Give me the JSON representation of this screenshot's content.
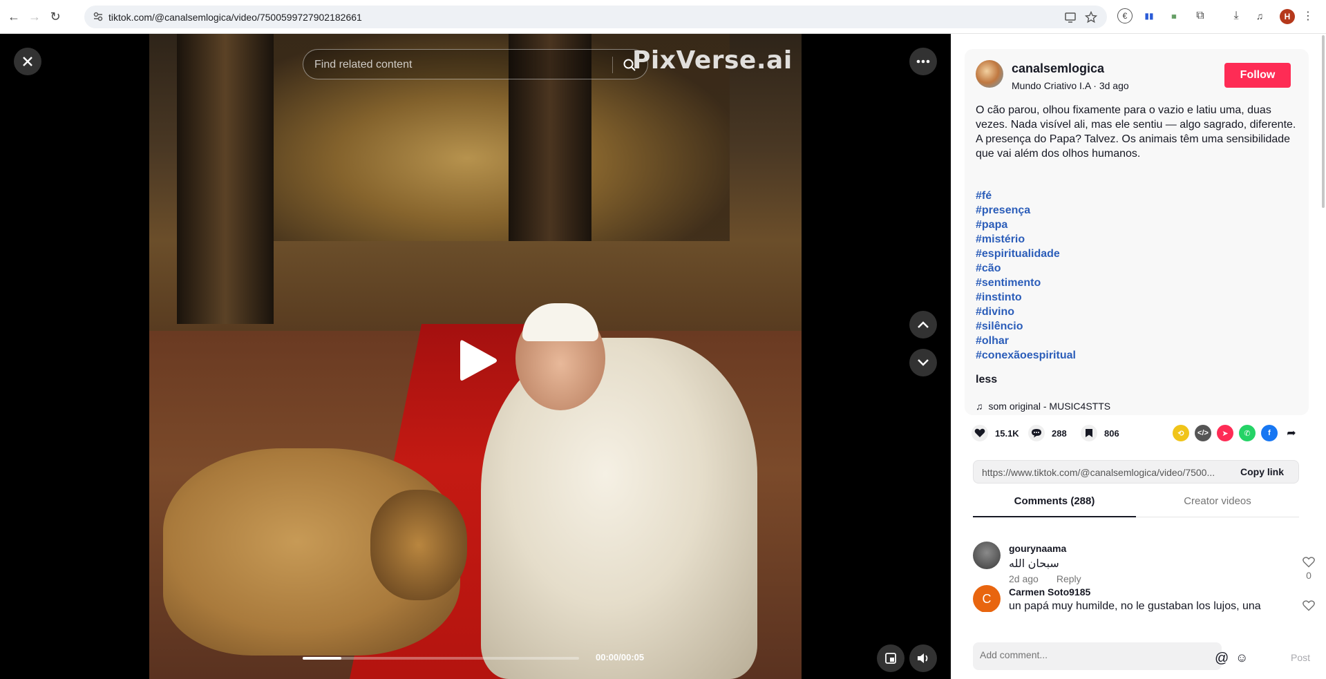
{
  "browser": {
    "url": "tiktok.com/@canalsemlogica/video/7500599727902182661",
    "profile_initial": "H"
  },
  "video": {
    "search_placeholder": "Find related content",
    "watermark": "PixVerse.ai",
    "time": "00:00/00:05",
    "progress_fraction": 0.14
  },
  "author": {
    "username": "canalsemlogica",
    "subline": "Mundo Criativo I.A · 3d ago",
    "follow_label": "Follow"
  },
  "caption": "O cão parou, olhou fixamente para o vazio e latiu uma, duas vezes. Nada visível ali, mas ele sentiu — algo sagrado, diferente. A presença do Papa? Talvez. Os animais têm uma sensibilidade que vai além dos olhos humanos.",
  "hashtags": [
    "#fé",
    "#presença",
    "#papa",
    "#mistério",
    "#espiritualidade",
    "#cão",
    "#sentimento",
    "#instinto",
    "#divino",
    "#silêncio",
    "#olhar",
    "#conexãoespiritual"
  ],
  "less_label": "less",
  "music": "som original - MUSIC4STTS",
  "stats": {
    "likes": "15.1K",
    "comments": "288",
    "saves": "806"
  },
  "share_link": {
    "url": "https://www.tiktok.com/@canalsemlogica/video/7500...",
    "copy_label": "Copy link"
  },
  "tabs": {
    "comments": "Comments (288)",
    "creator": "Creator videos"
  },
  "comments": [
    {
      "user": "gourynaama",
      "text": "سبحان الله",
      "time": "2d ago",
      "reply": "Reply",
      "likes": "0"
    },
    {
      "user": "Carmen Soto9185",
      "text": "un papá muy humilde, no le gustaban los lujos, una",
      "initial": "C"
    }
  ],
  "composer": {
    "placeholder": "Add comment...",
    "post_label": "Post"
  },
  "colors": {
    "follow": "#fe2c55",
    "hashtag": "#2b5db9"
  }
}
